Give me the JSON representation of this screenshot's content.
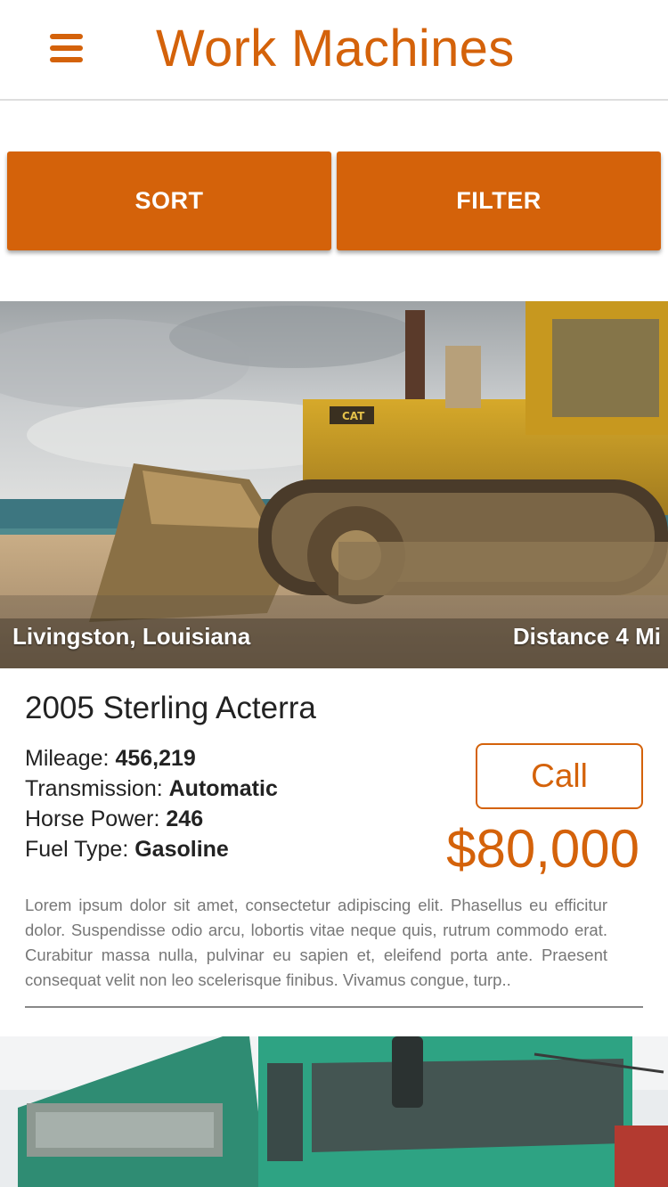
{
  "header": {
    "title": "Work Machines",
    "menu_icon": "hamburger-menu-icon",
    "accent_color": "#d4620a"
  },
  "toolbar": {
    "sort_label": "SORT",
    "filter_label": "FILTER"
  },
  "listings": [
    {
      "location": "Livingston, Louisiana",
      "distance": "Distance 4 Mi",
      "title": "2005 Sterling Acterra",
      "specs": [
        {
          "label": "Mileage:",
          "value": "456,219"
        },
        {
          "label": "Transmission:",
          "value": "Automatic"
        },
        {
          "label": "Horse Power:",
          "value": "246"
        },
        {
          "label": "Fuel Type:",
          "value": "Gasoline"
        }
      ],
      "call_label": "Call",
      "price": "$80,000",
      "description": "Lorem ipsum dolor sit amet, consectetur adipiscing elit. Phasellus eu efficitur dolor. Suspendisse odio arcu, lobortis vitae neque quis, rutrum commodo erat. Curabitur massa nulla, pulvinar eu sapien et, eleifend porta ante. Praesent consequat velit non leo scelerisque finibus. Vivamus congue, turp..",
      "image": "bulldozer-photo"
    },
    {
      "image": "green-dump-truck-photo"
    }
  ]
}
